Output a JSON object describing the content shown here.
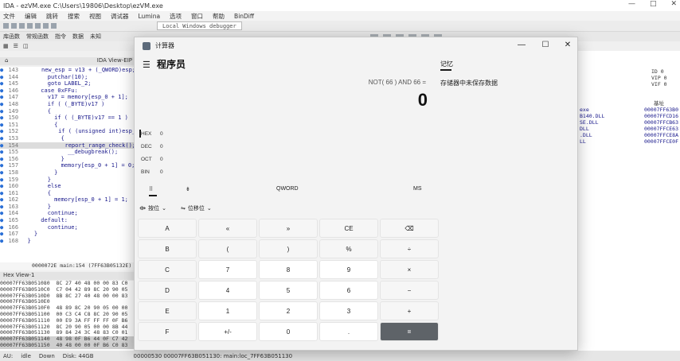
{
  "ida": {
    "title": "IDA - ezVM.exe C:\\Users\\19806\\Desktop\\ezVM.exe",
    "menu": [
      "文件",
      "编辑",
      "跳转",
      "搜索",
      "视图",
      "调试器",
      "Lumina",
      "选项",
      "窗口",
      "帮助",
      "BinDiff"
    ],
    "debugger_select": "Local Windows debugger",
    "views": [
      "库函数",
      "常规函数",
      "指令",
      "数据",
      "未知"
    ],
    "pseudocode_tab": "IDA View-EIP",
    "code_lines": [
      {
        "n": "143",
        "t": "      new_esp = v13 + (_QWORD)esp;"
      },
      {
        "n": "144",
        "t": "      putchar(10);"
      },
      {
        "n": "145",
        "t": "      goto LABEL_2;"
      },
      {
        "n": "146",
        "t": "    case 0xFFu:"
      },
      {
        "n": "147",
        "t": "      v17 = memory[esp_0 + 1];"
      },
      {
        "n": "148",
        "t": "      if ( (_BYTE)v17 )"
      },
      {
        "n": "149",
        "t": "      {"
      },
      {
        "n": "150",
        "t": "        if ( (_BYTE)v17 == 1 )"
      },
      {
        "n": "151",
        "t": "        {"
      },
      {
        "n": "152",
        "t": "          if ( (unsigned int)esp_"
      },
      {
        "n": "153",
        "t": "          {"
      },
      {
        "n": "154",
        "t": "            report_range_check();"
      },
      {
        "n": "155",
        "t": "            __debugbreak();"
      },
      {
        "n": "156",
        "t": "          }"
      },
      {
        "n": "157",
        "t": "          memory[esp_0 + 1] = 0;"
      },
      {
        "n": "158",
        "t": "        }"
      },
      {
        "n": "159",
        "t": "      }"
      },
      {
        "n": "160",
        "t": "      else"
      },
      {
        "n": "161",
        "t": "      {"
      },
      {
        "n": "162",
        "t": "        memory[esp_0 + 1] = 1;"
      },
      {
        "n": "163",
        "t": "      }"
      },
      {
        "n": "164",
        "t": "      continue;"
      },
      {
        "n": "165",
        "t": "    default:"
      },
      {
        "n": "166",
        "t": "      continue;"
      },
      {
        "n": "167",
        "t": "  }"
      },
      {
        "n": "168",
        "t": "}"
      }
    ],
    "code_status": "0000072E main:154 (7FF63B05132E)",
    "hex_title": "Hex View-1",
    "hex_lines": [
      "00007FF63B051080  8C 27 40 48 00 00 83 C0",
      "00007FF63B0510C0  C7 04 42 89 8C 20 90 05",
      "00007FF63B0510D0  8B 8C 27 40 48 00 00 83",
      "00007FF63B0510E0  ",
      "00007FF63B0510F0  48 89 8C 20 90 05 00 00",
      "00007FF63B051100  00 C3 C4 C8 8C 20 90 05",
      "00007FF63B051110  00 E9 3A FF FF FF 0F B6",
      "00007FF63B051120  8C 20 90 05 00 00 8B 44",
      "00007FF63B051130  89 84 24 3C 48 83 C0 01",
      "00007FF63B051140  48 98 0F B6 44 0F C7 42",
      "00007FF63B051150  40 48 00 00 0F B6 C0 83"
    ],
    "hex_status": "00000530 00007FF63B051130: main:loc_7FF63B051130",
    "status_bar": [
      "AU:",
      "idle",
      "Down",
      "Disk: 44GB"
    ],
    "registers": [
      "ID  0",
      "VIP 0",
      "VIF 0"
    ],
    "modules_header": "基址",
    "modules": [
      {
        "name": "exe",
        "base": "00007FF63B0"
      },
      {
        "name": "B140.DLL",
        "base": "00007FFCD16"
      },
      {
        "name": "SE.DLL",
        "base": "00007FFCB63"
      },
      {
        "name": "DLL",
        "base": "00007FFCE63"
      },
      {
        "name": ".DLL",
        "base": "00007FFCE8A"
      },
      {
        "name": "LL",
        "base": "00007FFCE0F"
      }
    ]
  },
  "calc": {
    "title": "计算器",
    "mode": "程序员",
    "expression": "NOT( 66 ) AND 66 =",
    "result": "0",
    "memory_tab": "记忆",
    "memory_message": "存储器中未保存数据",
    "radix": [
      {
        "label": "HEX",
        "value": "0"
      },
      {
        "label": "DEC",
        "value": "0"
      },
      {
        "label": "OCT",
        "value": "0"
      },
      {
        "label": "BIN",
        "value": "0"
      }
    ],
    "tabs": {
      "keypad": "⠿",
      "bits": "⇟",
      "word": "QWORD",
      "ms": "MS"
    },
    "bitwise_label": "按位",
    "shift_label": "位移位",
    "keys": [
      [
        "A",
        "«",
        "»",
        "CE",
        "⌫"
      ],
      [
        "B",
        "(",
        ")",
        "%",
        "÷"
      ],
      [
        "C",
        "7",
        "8",
        "9",
        "×"
      ],
      [
        "D",
        "4",
        "5",
        "6",
        "−"
      ],
      [
        "E",
        "1",
        "2",
        "3",
        "+"
      ],
      [
        "F",
        "+/-",
        "0",
        ".",
        "="
      ]
    ]
  }
}
